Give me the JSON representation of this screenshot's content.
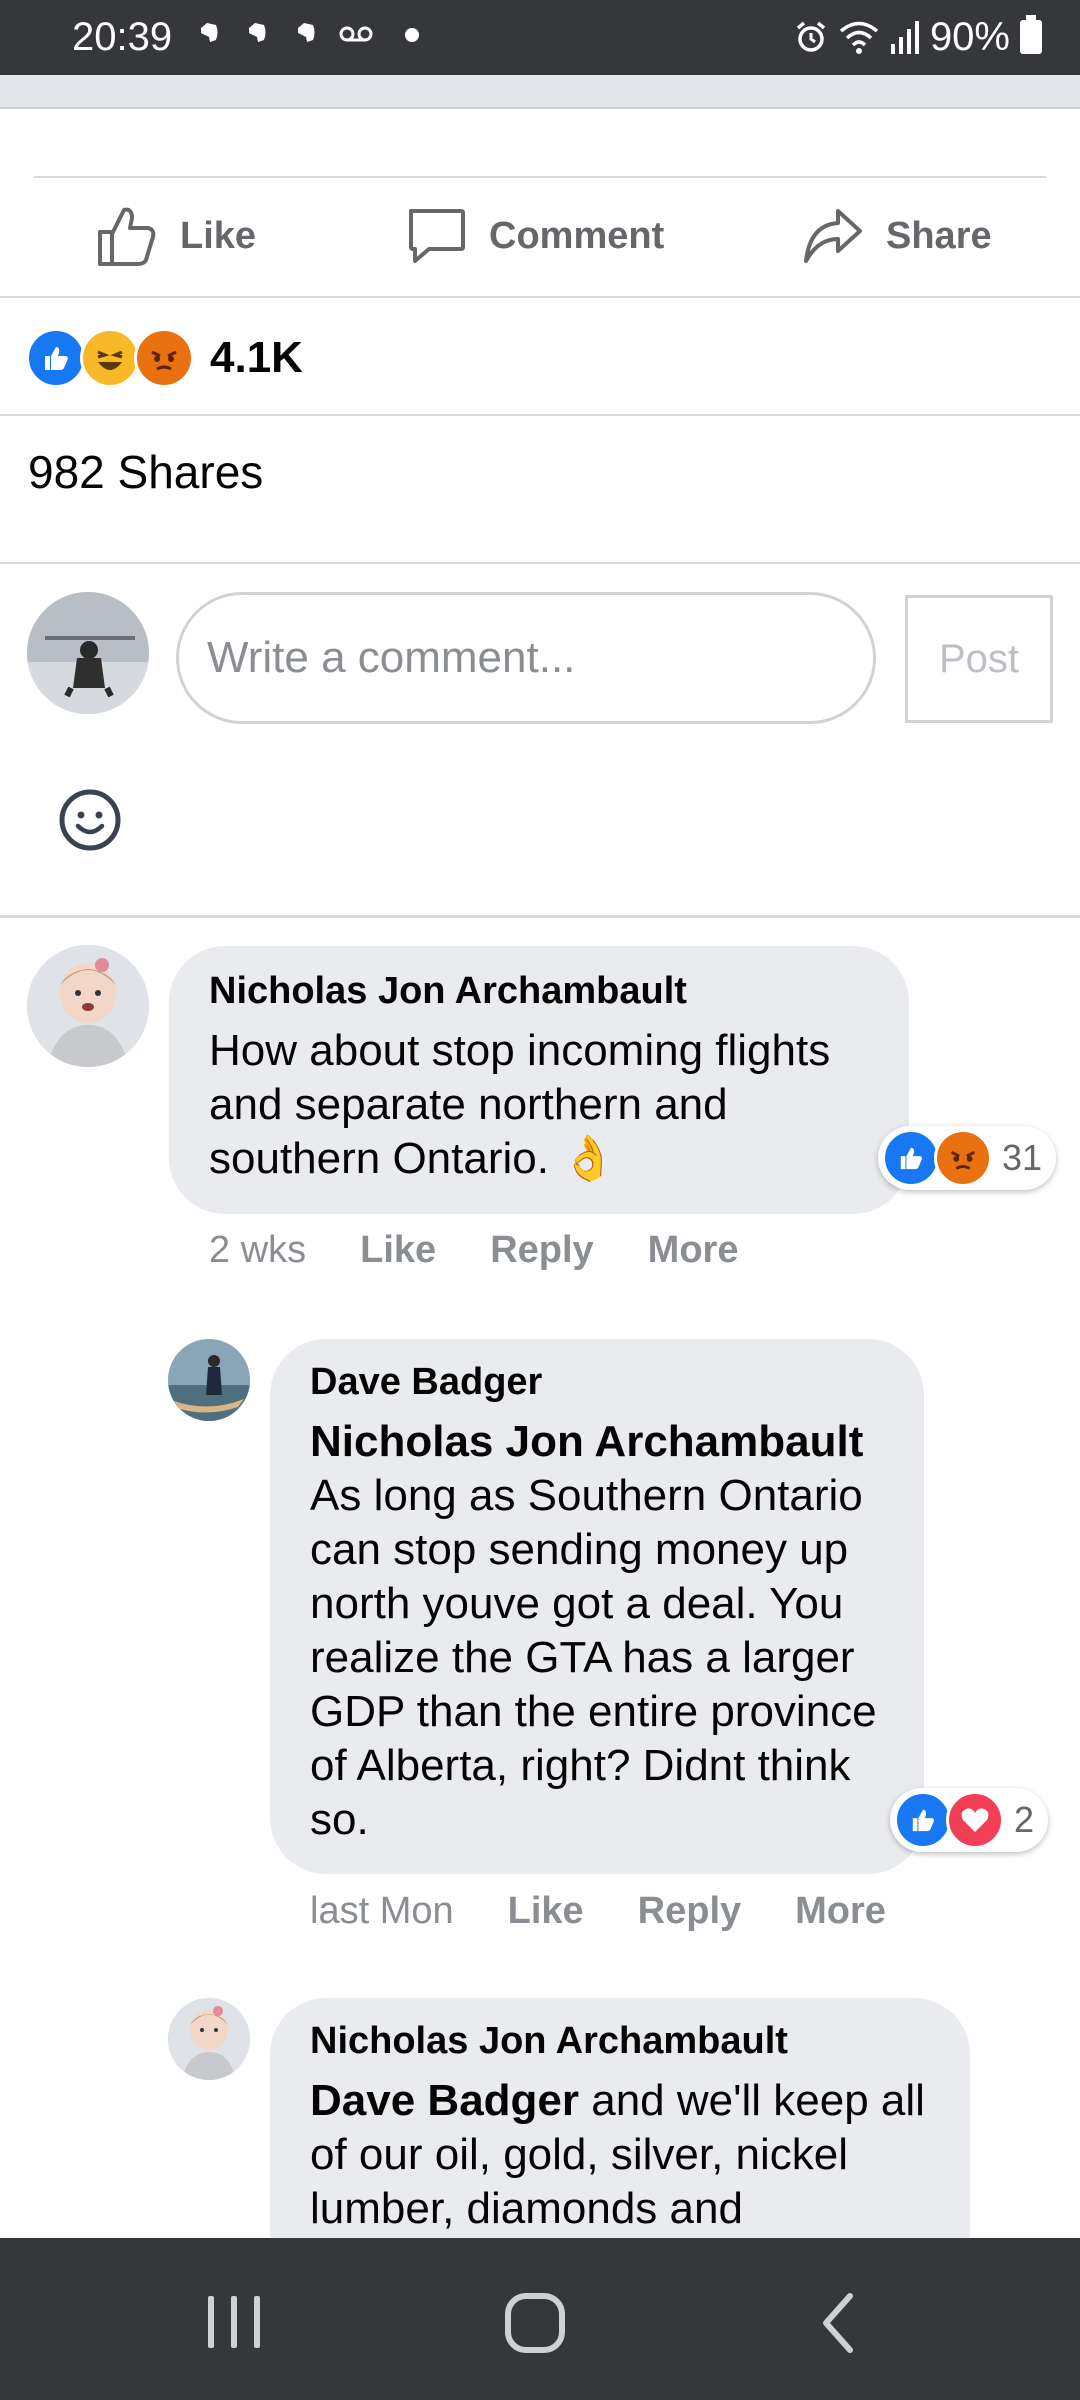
{
  "status_bar": {
    "time": "20:39",
    "battery": "90%",
    "icons": [
      "evernote-icon",
      "evernote-icon",
      "evernote-icon",
      "voicemail-icon",
      "dot-icon",
      "alarm-icon",
      "wifi-icon",
      "signal-icon",
      "battery-icon"
    ]
  },
  "actions": {
    "like": "Like",
    "comment": "Comment",
    "share": "Share"
  },
  "reactions": {
    "icons": [
      "like-reaction-icon",
      "haha-reaction-icon",
      "angry-reaction-icon"
    ],
    "count": "4.1K"
  },
  "shares": "982 Shares",
  "composer": {
    "placeholder": "Write a comment...",
    "post_label": "Post"
  },
  "comments": [
    {
      "author": "Nicholas Jon Archambault",
      "text": "How about stop incoming flights and separate northern and southern Ontario. 👌",
      "time": "2 wks",
      "like": "Like",
      "reply": "Reply",
      "more": "More",
      "reaction_count": "31"
    },
    {
      "author": "Dave Badger",
      "mention": "Nicholas Jon Archambault",
      "text": "As long as Southern Ontario can stop sending money up north youve got a deal. You realize the GTA has a larger GDP than the entire province of Alberta, right? Didnt think so.",
      "time": "last Mon",
      "like": "Like",
      "reply": "Reply",
      "more": "More",
      "reaction_count": "2"
    },
    {
      "author": "Nicholas Jon Archambault",
      "mention": "Dave Badger",
      "text": " and we'll keep all of our oil, gold, silver, nickel lumber, diamonds and"
    }
  ],
  "colors": {
    "status_bar": "#36373b",
    "bubble": "#eaebee",
    "like_blue": "#1877f2",
    "muted_text": "#65676b"
  }
}
